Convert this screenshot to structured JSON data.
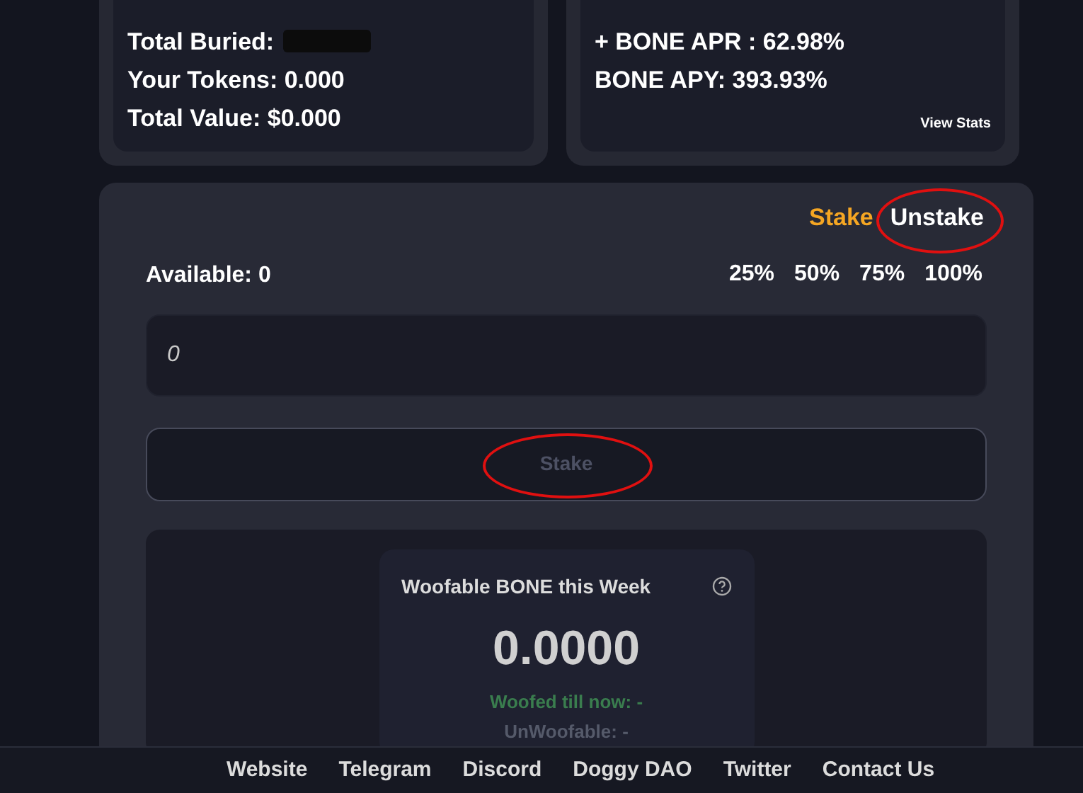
{
  "summary_card": {
    "lines": [
      {
        "label": "Total Buried:",
        "redacted": true
      },
      {
        "label": "Your Tokens: 0.000",
        "redacted": false
      },
      {
        "label": "Total Value: $0.000",
        "redacted": false
      }
    ]
  },
  "apr_card": {
    "lines": [
      "+ BONE APR : 62.98%",
      "BONE APY: 393.93%"
    ],
    "link": "View Stats"
  },
  "mode_tabs": [
    {
      "label": "Stake",
      "selected": true,
      "annotated": false
    },
    {
      "label": "Unstake",
      "selected": false,
      "annotated": true
    }
  ],
  "available": "Available: 0",
  "percent_buttons": [
    "25%",
    "50%",
    "75%",
    "100%"
  ],
  "amount_field": {
    "placeholder": "0"
  },
  "stake_button": {
    "label": "Stake",
    "disabled": true,
    "annotated": true
  },
  "woof_card": {
    "title": "Woofable BONE this Week",
    "amount": "0.0000",
    "woofed": "Woofed till now: -",
    "unwoofable": "UnWoofable: -"
  },
  "footer_links": [
    "Website",
    "Telegram",
    "Discord",
    "Doggy DAO",
    "Twitter",
    "Contact Us"
  ]
}
